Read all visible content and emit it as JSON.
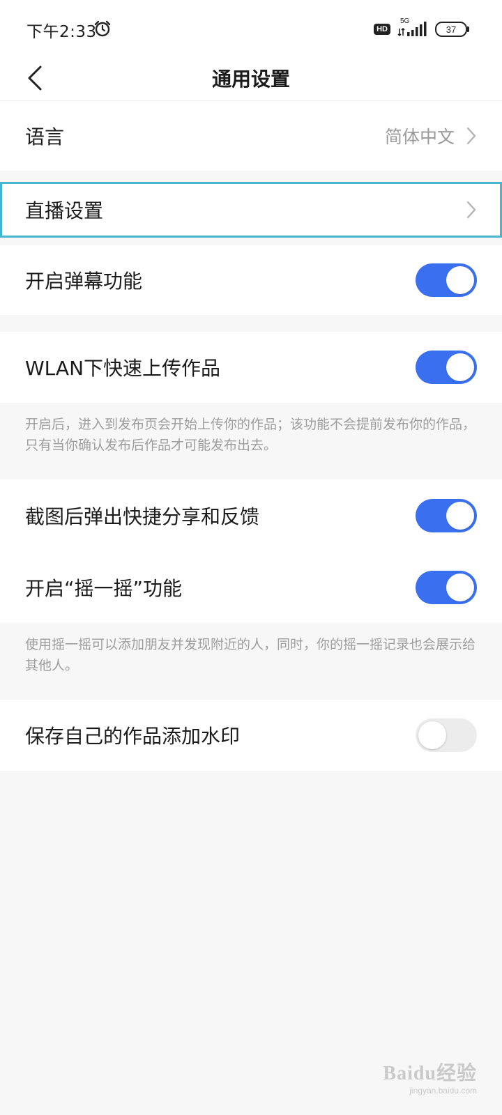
{
  "status_bar": {
    "time": "下午2:33",
    "alarm_icon": "alarm-clock-icon",
    "hd_label": "HD",
    "network_label": "5G",
    "battery_level": "37"
  },
  "header": {
    "back_icon": "chevron-left-icon",
    "title": "通用设置"
  },
  "settings": {
    "language": {
      "label": "语言",
      "value": "简体中文"
    },
    "live": {
      "label": "直播设置"
    },
    "danmaku": {
      "label": "开启弹幕功能",
      "enabled": true
    },
    "wlan_upload": {
      "label": "WLAN下快速上传作品",
      "enabled": true,
      "description": "开启后，进入到发布页会开始上传你的作品；该功能不会提前发布你的作品，只有当你确认发布后作品才可能发布出去。"
    },
    "screenshot_share": {
      "label": "截图后弹出快捷分享和反馈",
      "enabled": true
    },
    "shake": {
      "label": "开启“摇一摇”功能",
      "enabled": true,
      "description": "使用摇一摇可以添加朋友并发现附近的人，同时，你的摇一摇记录也会展示给其他人。"
    },
    "watermark": {
      "label": "保存自己的作品添加水印",
      "enabled": false
    }
  },
  "colors": {
    "toggle_on": "#3a70f0",
    "toggle_off": "#ececec",
    "highlight_border": "#46b6d0",
    "background": "#f7f7f7"
  },
  "overlay_watermark": {
    "main": "Baidu经验",
    "sub": "jingyan.baidu.com"
  }
}
